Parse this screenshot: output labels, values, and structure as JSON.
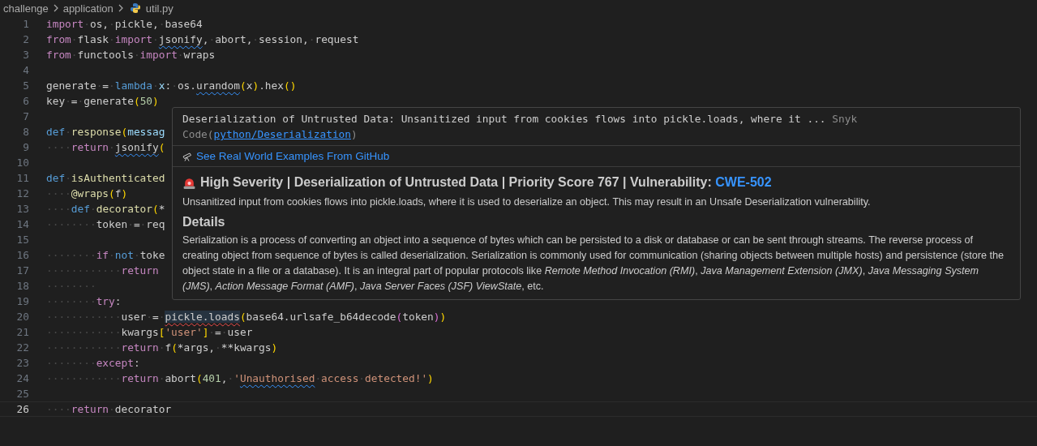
{
  "breadcrumb": {
    "folders": [
      "challenge",
      "application"
    ],
    "file": "util.py"
  },
  "editor": {
    "lines": [
      {
        "number": "1",
        "current": false,
        "tokens": [
          {
            "text": "import",
            "kind": "keyword"
          },
          {
            "text": "·os,·pickle,·base64",
            "kind": "plain"
          }
        ]
      },
      {
        "number": "2",
        "current": false,
        "tokens": [
          {
            "text": "from",
            "kind": "keyword"
          },
          {
            "text": "·flask·",
            "kind": "plain"
          },
          {
            "text": "import",
            "kind": "keyword"
          },
          {
            "text": "·",
            "kind": "plain"
          },
          {
            "text": "jsonify",
            "kind": "info-mark"
          },
          {
            "text": ",·abort,·session,·request",
            "kind": "plain"
          }
        ]
      },
      {
        "number": "3",
        "current": false,
        "tokens": [
          {
            "text": "from",
            "kind": "keyword"
          },
          {
            "text": "·functools·",
            "kind": "plain"
          },
          {
            "text": "import",
            "kind": "keyword"
          },
          {
            "text": "·wraps",
            "kind": "plain"
          }
        ]
      },
      {
        "number": "4",
        "current": false
      },
      {
        "number": "5",
        "current": false,
        "tokens": [
          {
            "text": "generate·=·",
            "kind": "plain"
          },
          {
            "text": "lambda",
            "kind": "storage"
          },
          {
            "text": "·x",
            "kind": "param"
          },
          {
            "text": ":·os.",
            "kind": "plain"
          },
          {
            "text": "urandom",
            "kind": "info-mark"
          },
          {
            "text": "(",
            "kind": "bracket"
          },
          {
            "text": "x",
            "kind": "plain"
          },
          {
            "text": ")",
            "kind": "bracket"
          },
          {
            "text": ".hex",
            "kind": "plain"
          },
          {
            "text": "()",
            "kind": "bracket"
          }
        ]
      },
      {
        "number": "6",
        "current": false,
        "tokens": [
          {
            "text": "key·=·generate",
            "kind": "plain"
          },
          {
            "text": "(",
            "kind": "bracket"
          },
          {
            "text": "50",
            "kind": "number"
          },
          {
            "text": ")",
            "kind": "bracket"
          }
        ]
      },
      {
        "number": "7",
        "current": false
      },
      {
        "number": "8",
        "current": false,
        "tokens": [
          {
            "text": "def",
            "kind": "storage"
          },
          {
            "text": "·",
            "kind": "plain"
          },
          {
            "text": "response",
            "kind": "function"
          },
          {
            "text": "(",
            "kind": "bracket"
          },
          {
            "text": "messag",
            "kind": "param"
          }
        ]
      },
      {
        "number": "9",
        "current": false,
        "tokens": [
          {
            "text": "····",
            "kind": "plain"
          },
          {
            "text": "return",
            "kind": "keyword"
          },
          {
            "text": "·",
            "kind": "plain"
          },
          {
            "text": "jsonify",
            "kind": "info-mark"
          },
          {
            "text": "(",
            "kind": "bracket"
          }
        ]
      },
      {
        "number": "10",
        "current": false
      },
      {
        "number": "11",
        "current": false,
        "tokens": [
          {
            "text": "def",
            "kind": "storage"
          },
          {
            "text": "·",
            "kind": "plain"
          },
          {
            "text": "isAuthenticated",
            "kind": "function"
          }
        ]
      },
      {
        "number": "12",
        "current": false,
        "tokens": [
          {
            "text": "····",
            "kind": "plain"
          },
          {
            "text": "@wraps",
            "kind": "function"
          },
          {
            "text": "(",
            "kind": "bracket"
          },
          {
            "text": "f",
            "kind": "plain"
          },
          {
            "text": ")",
            "kind": "bracket"
          }
        ]
      },
      {
        "number": "13",
        "current": false,
        "tokens": [
          {
            "text": "····",
            "kind": "plain"
          },
          {
            "text": "def",
            "kind": "storage"
          },
          {
            "text": "·",
            "kind": "plain"
          },
          {
            "text": "decorator",
            "kind": "function"
          },
          {
            "text": "(",
            "kind": "bracket"
          },
          {
            "text": "*",
            "kind": "plain"
          }
        ]
      },
      {
        "number": "14",
        "current": false,
        "tokens": [
          {
            "text": "········token·=·req",
            "kind": "plain"
          }
        ]
      },
      {
        "number": "15",
        "current": false
      },
      {
        "number": "16",
        "current": false,
        "tokens": [
          {
            "text": "········",
            "kind": "plain"
          },
          {
            "text": "if",
            "kind": "keyword"
          },
          {
            "text": "·",
            "kind": "plain"
          },
          {
            "text": "not",
            "kind": "storage"
          },
          {
            "text": "·toke",
            "kind": "plain"
          }
        ]
      },
      {
        "number": "17",
        "current": false,
        "tokens": [
          {
            "text": "············",
            "kind": "plain"
          },
          {
            "text": "return",
            "kind": "keyword"
          }
        ]
      },
      {
        "number": "18",
        "current": false,
        "tokens": [
          {
            "text": "········",
            "kind": "plain"
          }
        ]
      },
      {
        "number": "19",
        "current": false,
        "tokens": [
          {
            "text": "········",
            "kind": "plain"
          },
          {
            "text": "try",
            "kind": "keyword"
          },
          {
            "text": ":",
            "kind": "plain"
          }
        ]
      },
      {
        "number": "20",
        "current": false,
        "tokens": [
          {
            "text": "············user·=·",
            "kind": "plain"
          },
          {
            "text": "pickle.loads",
            "kind": "error-mark"
          },
          {
            "text": "(",
            "kind": "bracket"
          },
          {
            "text": "base64.urlsafe_b64decode",
            "kind": "plain"
          },
          {
            "text": "(",
            "kind": "bracket2"
          },
          {
            "text": "token",
            "kind": "plain"
          },
          {
            "text": ")",
            "kind": "bracket2"
          },
          {
            "text": ")",
            "kind": "bracket"
          }
        ]
      },
      {
        "number": "21",
        "current": false,
        "tokens": [
          {
            "text": "············kwargs",
            "kind": "plain"
          },
          {
            "text": "[",
            "kind": "bracket"
          },
          {
            "text": "'user'",
            "kind": "string"
          },
          {
            "text": "]",
            "kind": "bracket"
          },
          {
            "text": "·=·user",
            "kind": "plain"
          }
        ]
      },
      {
        "number": "22",
        "current": false,
        "tokens": [
          {
            "text": "············",
            "kind": "plain"
          },
          {
            "text": "return",
            "kind": "keyword"
          },
          {
            "text": "·f",
            "kind": "plain"
          },
          {
            "text": "(",
            "kind": "bracket"
          },
          {
            "text": "*args,·**kwargs",
            "kind": "plain"
          },
          {
            "text": ")",
            "kind": "bracket"
          }
        ]
      },
      {
        "number": "23",
        "current": false,
        "tokens": [
          {
            "text": "········",
            "kind": "plain"
          },
          {
            "text": "except",
            "kind": "keyword"
          },
          {
            "text": ":",
            "kind": "plain"
          }
        ]
      },
      {
        "number": "24",
        "current": false,
        "tokens": [
          {
            "text": "············",
            "kind": "plain"
          },
          {
            "text": "return",
            "kind": "keyword"
          },
          {
            "text": "·abort",
            "kind": "plain"
          },
          {
            "text": "(",
            "kind": "bracket"
          },
          {
            "text": "401",
            "kind": "number"
          },
          {
            "text": ",·",
            "kind": "plain"
          },
          {
            "text": "'",
            "kind": "string"
          },
          {
            "text": "Unauthorised",
            "kind": "string-info-mark"
          },
          {
            "text": "·access·detected!'",
            "kind": "string"
          },
          {
            "text": ")",
            "kind": "bracket"
          }
        ]
      },
      {
        "number": "25",
        "current": false
      },
      {
        "number": "26",
        "current": true,
        "tokens": [
          {
            "text": "····",
            "kind": "plain"
          },
          {
            "text": "return",
            "kind": "keyword"
          },
          {
            "text": "·decorator",
            "kind": "plain"
          }
        ]
      }
    ]
  },
  "hover": {
    "message": "Deserialization of Untrusted Data: Unsanitized input from cookies flows into pickle.loads, where it ...",
    "source": "Snyk Code(",
    "rule_link": "python/Deserialization",
    "source_end": ")",
    "examples_link": "See Real World Examples From GitHub",
    "headline": "High Severity | Deserialization of Untrusted Data | Priority Score 767 | Vulnerability: ",
    "cwe_link": "CWE-502",
    "summary": "Unsanitized input from cookies flows into pickle.loads, where it is used to deserialize an object. This may result in an Unsafe Deserialization vulnerability.",
    "details_heading": "Details",
    "details": "Serialization is a process of converting an object into a sequence of bytes which can be persisted to a disk or database or can be sent through streams. The reverse process of creating object from sequence of bytes is called deserialization. Serialization is commonly used for communication (sharing objects between multiple hosts) and persistence (store the object state in a file or a database). It is an integral part of popular protocols like *Remote Method Invocation (RMI)*, *Java Management Extension (JMX)*, *Java Messaging System (JMS)*, *Action Message Format (AMF)*, *Java Server Faces (JSF) ViewState*, etc."
  }
}
